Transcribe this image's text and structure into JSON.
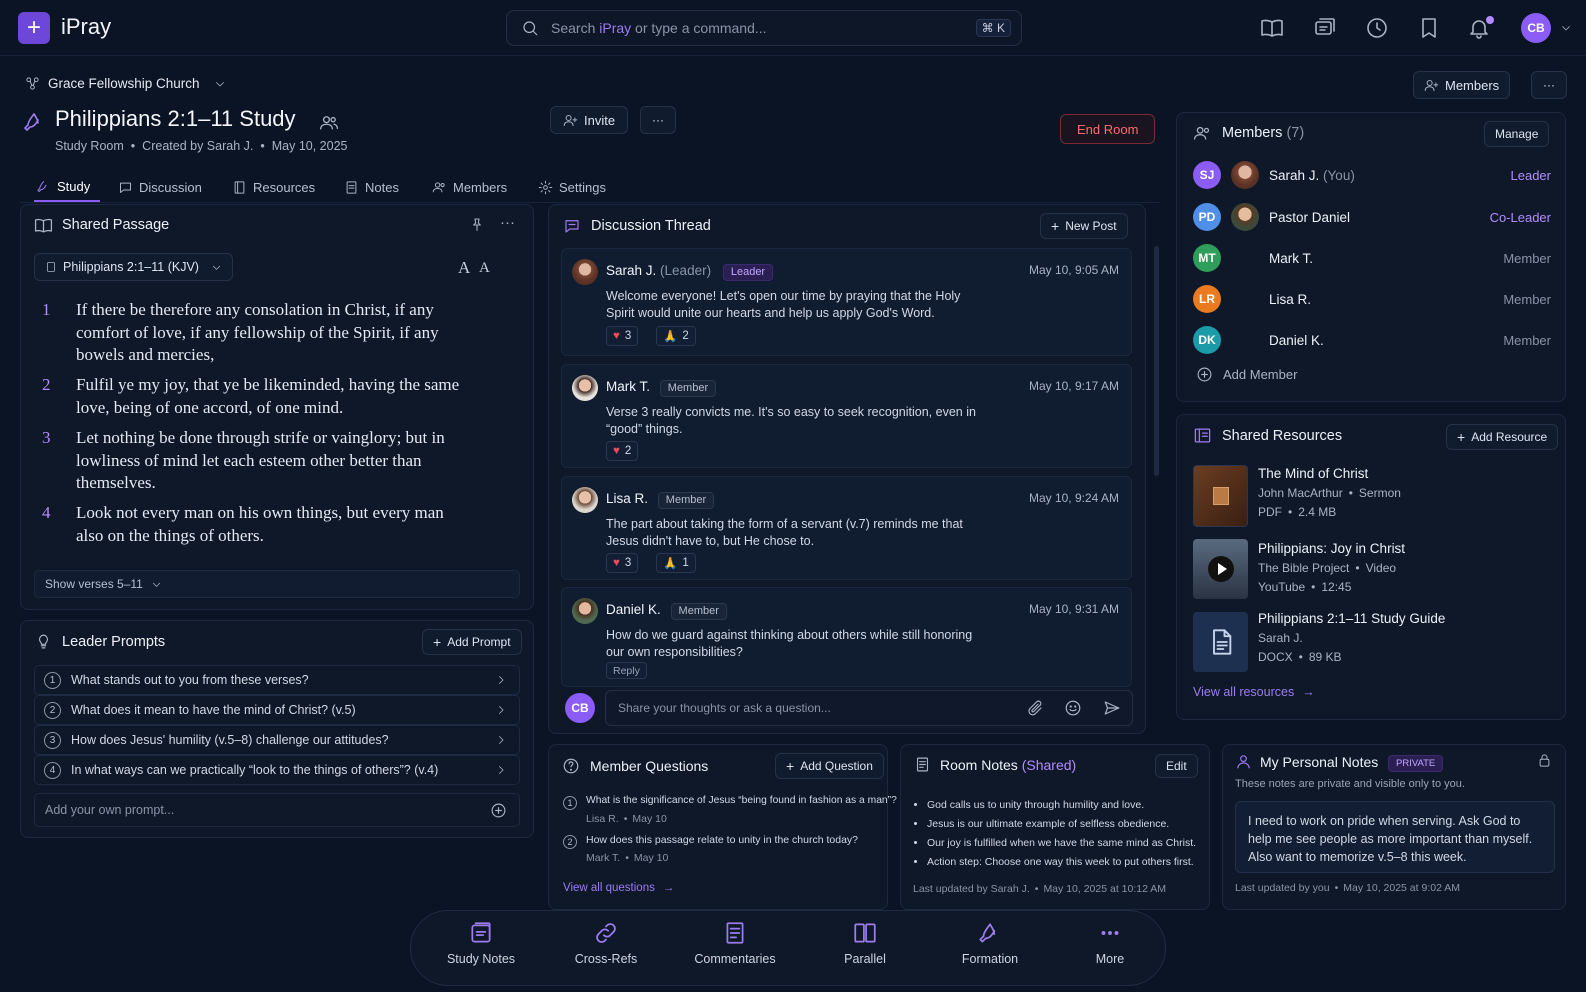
{
  "app": {
    "title": "iPray",
    "logo_glyph": "+"
  },
  "search": {
    "placeholder_prefix": "Search ",
    "placeholder_brand": "iPray",
    "placeholder_suffix": " or type a command...",
    "shortcut": "⌘ K"
  },
  "user": {
    "initials": "CB"
  },
  "church": {
    "name": "Grace Fellowship Church"
  },
  "header": {
    "members_button": "Members",
    "more": "···"
  },
  "room": {
    "title": "Philippians 2:1–11 Study",
    "type": "Study Room",
    "creator": "Created by Sarah J.",
    "date": "May 10, 2025",
    "invite_label": "Invite",
    "end_label": "End Room",
    "sep": "•"
  },
  "tabs": [
    {
      "label": "Study",
      "icon": "study-icon"
    },
    {
      "label": "Discussion",
      "icon": "chat-icon"
    },
    {
      "label": "Resources",
      "icon": "book-icon"
    },
    {
      "label": "Notes",
      "icon": "note-icon"
    },
    {
      "label": "Members",
      "icon": "people-icon"
    },
    {
      "label": "Settings",
      "icon": "gear-icon"
    }
  ],
  "passage": {
    "title": "Shared Passage",
    "version_select": "Philippians 2:1–11 (KJV)",
    "font_controls": [
      "A",
      "A"
    ],
    "verses": [
      {
        "num": "1",
        "text": "If there be therefore any consolation in Christ, if any comfort of love, if any fellowship of the Spirit, if any bowels and mercies,"
      },
      {
        "num": "2",
        "text": "Fulfil ye my joy, that ye be likeminded, having the same love, being of one accord, of one mind."
      },
      {
        "num": "3",
        "text": "Let nothing be done through strife or vainglory; but in lowliness of mind let each esteem other better than themselves."
      },
      {
        "num": "4",
        "text": "Look not every man on his own things, but every man also on the things of others."
      }
    ],
    "show_more": "Show verses 5–11"
  },
  "prompts": {
    "title": "Leader Prompts",
    "add_label": "Add Prompt",
    "items": [
      {
        "num": "1",
        "text": "What stands out to you from these verses?"
      },
      {
        "num": "2",
        "text": "What does it mean to have the mind of Christ? (v.5)"
      },
      {
        "num": "3",
        "text": "How does Jesus' humility (v.5–8) challenge our attitudes?"
      },
      {
        "num": "4",
        "text": "In what ways can we practically “look to the things of others”? (v.4)"
      }
    ],
    "custom_placeholder": "Add your own prompt..."
  },
  "discussion": {
    "title": "Discussion Thread",
    "new_post": "New Post",
    "posts": [
      {
        "name": "Sarah J.",
        "sub": "(Leader)",
        "tag": "Leader",
        "time": "May 10, 9:05 AM",
        "text": "Welcome everyone! Let's open our time by praying that the Holy Spirit would unite our hearts and help us apply God's Word.",
        "hearts": "3",
        "prays": "2"
      },
      {
        "name": "Mark T.",
        "tag": "Member",
        "time": "May 10, 9:17 AM",
        "text": "Verse 3 really convicts me. It's so easy to seek recognition, even in “good” things.",
        "hearts": "2"
      },
      {
        "name": "Lisa R.",
        "tag": "Member",
        "time": "May 10, 9:24 AM",
        "text": "The part about taking the form of a servant (v.7) reminds me that Jesus didn't have to, but He chose to.",
        "hearts": "3",
        "prays": "1"
      },
      {
        "name": "Daniel K.",
        "tag": "Member",
        "time": "May 10, 9:31 AM",
        "text": "How do we guard against thinking about others while still honoring our own responsibilities?",
        "reply": "Reply"
      }
    ],
    "composer_placeholder": "Share your thoughts or ask a question..."
  },
  "members": {
    "title": "Members",
    "count": "(7)",
    "manage": "Manage",
    "items": [
      {
        "initials": "SJ",
        "name": "Sarah J.",
        "suffix": "(You)",
        "role": "Leader",
        "color": "#8b5cf6",
        "photo": true
      },
      {
        "initials": "PD",
        "name": "Pastor Daniel",
        "suffix": "",
        "role": "Co-Leader",
        "color": "#4f8fe8",
        "photo": true
      },
      {
        "initials": "MT",
        "name": "Mark T.",
        "suffix": "",
        "role": "Member",
        "color": "#2f9e5b",
        "photo": false
      },
      {
        "initials": "LR",
        "name": "Lisa R.",
        "suffix": "",
        "role": "Member",
        "color": "#ea7a1f",
        "photo": false
      },
      {
        "initials": "DK",
        "name": "Daniel K.",
        "suffix": "",
        "role": "Member",
        "color": "#1b9aa8",
        "photo": false
      }
    ],
    "add_member": "Add Member"
  },
  "resources": {
    "title": "Shared Resources",
    "add": "Add Resource",
    "items": [
      {
        "title": "The Mind of Christ",
        "line1": "John MacArthur",
        "line1b": "Sermon",
        "line2": "PDF",
        "line2b": "2.4 MB"
      },
      {
        "title": "Philippians: Joy in Christ",
        "line1": "The Bible Project",
        "line1b": "Video",
        "line2": "YouTube",
        "line2b": "12:45"
      },
      {
        "title": "Philippians 2:1–11 Study Guide",
        "line1": "Sarah J.",
        "line1b": "",
        "line2": "DOCX",
        "line2b": "89 KB"
      }
    ],
    "view_all": "View all resources"
  },
  "questions": {
    "title": "Member Questions",
    "add": "Add Question",
    "items": [
      {
        "num": "1",
        "text": "What is the significance of Jesus “being found in fashion as a man”?",
        "author": "Lisa R.",
        "date": "May 10"
      },
      {
        "num": "2",
        "text": "How does this passage relate to unity in the church today?",
        "author": "Mark T.",
        "date": "May 10"
      }
    ],
    "view_all": "View all questions"
  },
  "room_notes": {
    "title": "Room Notes",
    "shared": "(Shared)",
    "edit": "Edit",
    "items": [
      "God calls us to unity through humility and love.",
      "Jesus is our ultimate example of selfless obedience.",
      "Our joy is fulfilled when we have the same mind as Christ.",
      "Action step: Choose one way this week to put others first."
    ],
    "updated": "Last updated by Sarah J.",
    "updated_date": "May 10, 2025 at 10:12 AM"
  },
  "personal_notes": {
    "title": "My Personal Notes",
    "badge": "PRIVATE",
    "subtitle": "These notes are private and visible only to you.",
    "body": "I need to work on pride when serving. Ask God to help me see people as more important than myself. Also want to memorize v.5–8 this week.",
    "updated": "Last updated by you",
    "updated_date": "May 10, 2025 at 9:02 AM"
  },
  "bottom_nav": [
    {
      "label": "Study Notes",
      "icon": "study-notes-icon"
    },
    {
      "label": "Cross-Refs",
      "icon": "link-icon"
    },
    {
      "label": "Commentaries",
      "icon": "document-icon"
    },
    {
      "label": "Parallel",
      "icon": "parallel-columns-icon"
    },
    {
      "label": "Formation",
      "icon": "formation-icon"
    },
    {
      "label": "More",
      "icon": "more-icon"
    }
  ]
}
